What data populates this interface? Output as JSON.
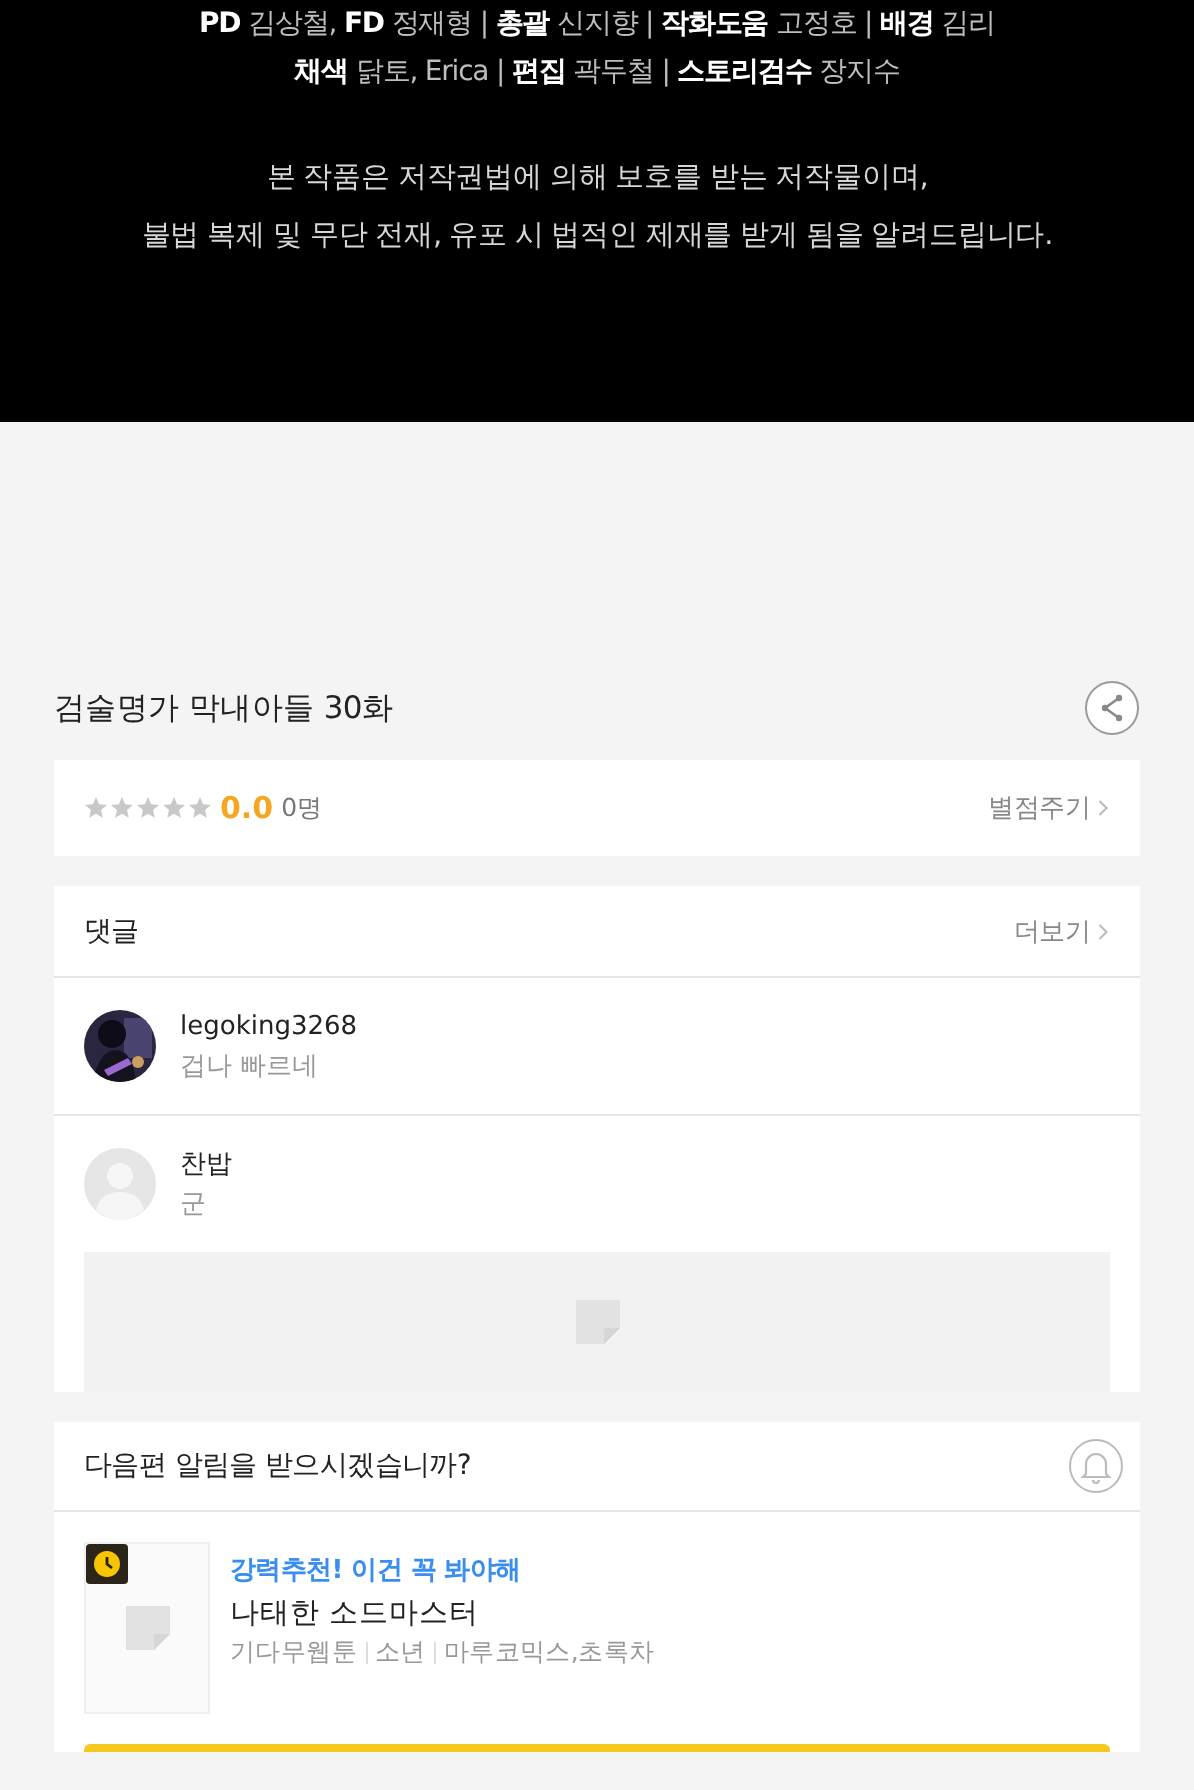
{
  "credits": [
    "**PD** 김상철, **FD** 정재형 | **총괄** 신지향 | **작화도움** 고정호 | **배경** 김리",
    "**채색** 닭토, Erica | **편집** 곽두철 | **스토리검수** 장지수"
  ],
  "notice": [
    "본 작품은 저작권법에 의해 보호를 받는 저작물이며,",
    "불법 복제 및 무단 전재, 유포 시 법적인 제재를 받게 됨을 알려드립니다."
  ],
  "episode_title": "검술명가 막내아들 30화",
  "rating": {
    "stars": 0,
    "score": "0.0",
    "count": "0명",
    "action": "별점주기"
  },
  "comments": {
    "heading": "댓글",
    "more": "더보기",
    "items": [
      {
        "author": "legoking3268",
        "text": "겁나 빠르네",
        "kind": "picture"
      },
      {
        "author": "찬밥",
        "text": "군",
        "kind": "default"
      }
    ]
  },
  "notification": {
    "question": "다음편 알림을 받으시겠습니까?",
    "recommendation": {
      "tagline": "강력추천! 이건 꼭 봐야해",
      "title": "나태한 소드마스터",
      "meta": [
        "기다무웹툰",
        "소년",
        "마루코믹스,초록차"
      ]
    }
  }
}
